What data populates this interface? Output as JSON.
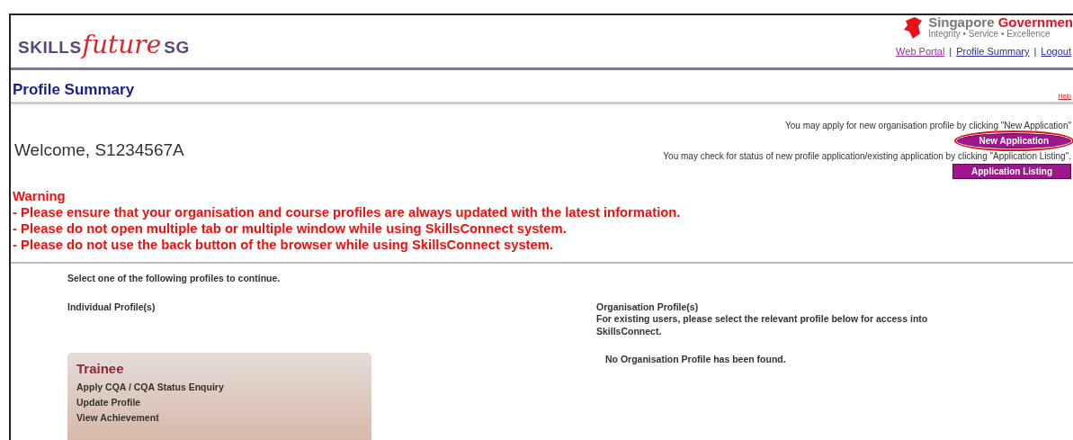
{
  "header": {
    "logo": {
      "left": "SKILLS",
      "script": "future",
      "right": "SG"
    },
    "gov_logo": {
      "name": "Singapore",
      "name_accent": "Governmen",
      "tagline": "Integrity • Service • Excellence"
    },
    "nav_separators": [
      "|",
      "|"
    ],
    "nav_links": [
      {
        "label": "Web Portal",
        "visited": true
      },
      {
        "label": "Profile Summary",
        "visited": false
      },
      {
        "label": "Logout",
        "visited": false
      }
    ]
  },
  "page_title": "Profile Summary",
  "help_link": "Help",
  "welcome": "Welcome, S1234567A",
  "actions": [
    {
      "note": "You may apply for new organisation profile by clicking \"New Application\"",
      "button": "New Application",
      "highlighted": true
    },
    {
      "note": "You may check for status of new profile application/existing application by clicking \"Application Listing\".",
      "button": "Application Listing",
      "highlighted": false
    }
  ],
  "warning": {
    "title": "Warning",
    "lines": [
      "- Please ensure that your organisation and course profiles are always updated with the latest information.",
      "- Please do not open multiple tab or multiple window while using SkillsConnect system.",
      "- Please do not use the back button of the browser while using SkillsConnect system."
    ]
  },
  "instruction": "Select one of the following profiles to continue.",
  "individual": {
    "heading": "Individual Profile(s)",
    "card": {
      "title": "Trainee",
      "links": [
        "Apply CQA / CQA Status Enquiry",
        "Update Profile",
        "View Achievement"
      ]
    }
  },
  "organisation": {
    "heading": "Organisation Profile(s)",
    "description": "For existing users, please select the relevant profile below for access into SkillsConnect.",
    "empty_message": "No Organisation Profile has been found."
  }
}
